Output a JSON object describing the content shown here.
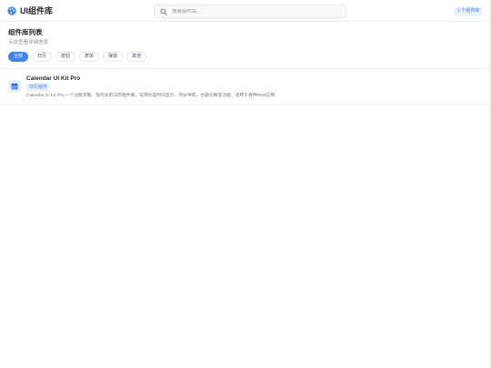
{
  "header": {
    "brand_title": "UI组件库",
    "search_placeholder": "搜索组件库...",
    "count_badge": "1 个组件库"
  },
  "section": {
    "title": "组件库列表",
    "subtitle": "点击查看详细信息"
  },
  "tabs": [
    {
      "label": "全部",
      "active": true
    },
    {
      "label": "日历",
      "active": false
    },
    {
      "label": "按钮",
      "active": false
    },
    {
      "label": "表单",
      "active": false
    },
    {
      "label": "弹窗",
      "active": false
    },
    {
      "label": "其他",
      "active": false
    }
  ],
  "cards": [
    {
      "title": "Calendar UI Kit Pro",
      "tag": "日历组件",
      "description": "Calendar UI Kit Pro 一个功能完整、现代化的日历组件库。支持动态时间显示、月份导航、主题切换等功能，适用于各种Web应用",
      "icon": "calendar-icon"
    }
  ],
  "colors": {
    "accent": "#3b82f6",
    "badge_bg": "#e8f0fe",
    "badge_text": "#3b7dd8"
  },
  "icons": {
    "brand": "palette-icon",
    "search": "search-icon"
  }
}
